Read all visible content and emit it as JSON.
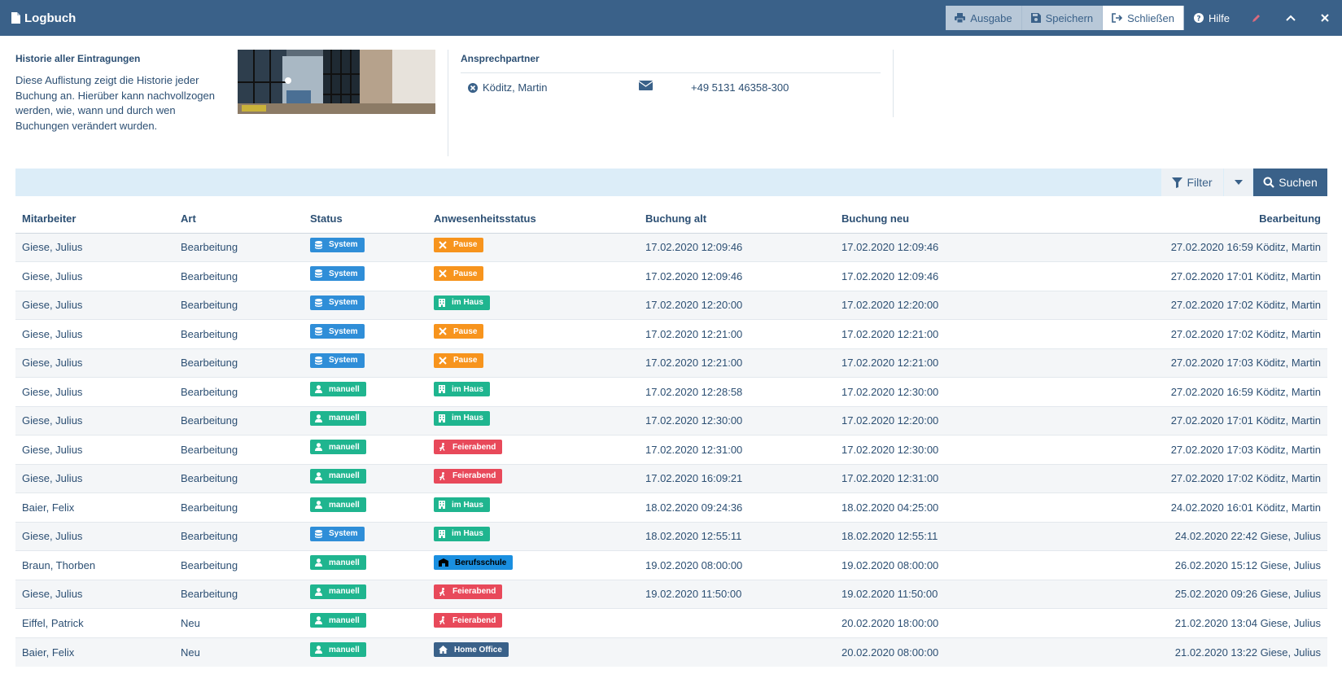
{
  "header": {
    "title": "Logbuch",
    "buttons": {
      "ausgabe": "Ausgabe",
      "speichern": "Speichern",
      "schliessen": "Schließen",
      "hilfe": "Hilfe"
    }
  },
  "info": {
    "title": "Historie aller Eintragungen",
    "text": "Diese Auflistung zeigt die Historie jeder Buchung an. Hierüber kann nachvollzogen werden, wie, wann und durch wen Buchungen verändert wurden."
  },
  "contact": {
    "title": "Ansprechpartner",
    "name": "Köditz, Martin",
    "phone": "+49 5131 46358-300"
  },
  "toolbar": {
    "filter": "Filter",
    "search": "Suchen"
  },
  "table": {
    "headers": [
      "Mitarbeiter",
      "Art",
      "Status",
      "Anwesenheitsstatus",
      "Buchung alt",
      "Buchung neu",
      "Bearbeitung"
    ],
    "rows": [
      [
        "Giese, Julius",
        "Bearbeitung",
        "System",
        "Pause",
        "17.02.2020 12:09:46",
        "17.02.2020 12:09:46",
        "27.02.2020 16:59 Köditz, Martin"
      ],
      [
        "Giese, Julius",
        "Bearbeitung",
        "System",
        "Pause",
        "17.02.2020 12:09:46",
        "17.02.2020 12:09:46",
        "27.02.2020 17:01 Köditz, Martin"
      ],
      [
        "Giese, Julius",
        "Bearbeitung",
        "System",
        "im Haus",
        "17.02.2020 12:20:00",
        "17.02.2020 12:20:00",
        "27.02.2020 17:02 Köditz, Martin"
      ],
      [
        "Giese, Julius",
        "Bearbeitung",
        "System",
        "Pause",
        "17.02.2020 12:21:00",
        "17.02.2020 12:21:00",
        "27.02.2020 17:02 Köditz, Martin"
      ],
      [
        "Giese, Julius",
        "Bearbeitung",
        "System",
        "Pause",
        "17.02.2020 12:21:00",
        "17.02.2020 12:21:00",
        "27.02.2020 17:03 Köditz, Martin"
      ],
      [
        "Giese, Julius",
        "Bearbeitung",
        "manuell",
        "im Haus",
        "17.02.2020 12:28:58",
        "17.02.2020 12:30:00",
        "27.02.2020 16:59 Köditz, Martin"
      ],
      [
        "Giese, Julius",
        "Bearbeitung",
        "manuell",
        "im Haus",
        "17.02.2020 12:30:00",
        "17.02.2020 12:20:00",
        "27.02.2020 17:01 Köditz, Martin"
      ],
      [
        "Giese, Julius",
        "Bearbeitung",
        "manuell",
        "Feierabend",
        "17.02.2020 12:31:00",
        "17.02.2020 12:30:00",
        "27.02.2020 17:03 Köditz, Martin"
      ],
      [
        "Giese, Julius",
        "Bearbeitung",
        "manuell",
        "Feierabend",
        "17.02.2020 16:09:21",
        "17.02.2020 12:31:00",
        "27.02.2020 17:02 Köditz, Martin"
      ],
      [
        "Baier, Felix",
        "Bearbeitung",
        "manuell",
        "im Haus",
        "18.02.2020 09:24:36",
        "18.02.2020 04:25:00",
        "24.02.2020 16:01 Köditz, Martin"
      ],
      [
        "Giese, Julius",
        "Bearbeitung",
        "System",
        "im Haus",
        "18.02.2020 12:55:11",
        "18.02.2020 12:55:11",
        "24.02.2020 22:42 Giese, Julius"
      ],
      [
        "Braun, Thorben",
        "Bearbeitung",
        "manuell",
        "Berufsschule",
        "19.02.2020 08:00:00",
        "19.02.2020 08:00:00",
        "26.02.2020 15:12 Giese, Julius"
      ],
      [
        "Giese, Julius",
        "Bearbeitung",
        "manuell",
        "Feierabend",
        "19.02.2020 11:50:00",
        "19.02.2020 11:50:00",
        "25.02.2020 09:26 Giese, Julius"
      ],
      [
        "Eiffel, Patrick",
        "Neu",
        "manuell",
        "Feierabend",
        "",
        "20.02.2020 18:00:00",
        "21.02.2020 13:04 Giese, Julius"
      ],
      [
        "Baier, Felix",
        "Neu",
        "manuell",
        "Home Office",
        "",
        "20.02.2020 08:00:00",
        "21.02.2020 13:22 Giese, Julius"
      ]
    ]
  },
  "colors": {
    "header": "#3a6189",
    "system": "#2f8ed8",
    "manuell": "#1fb58f",
    "pause": "#f7941d",
    "imhaus": "#1fb58f",
    "feierabend": "#e8495a",
    "berufsschule": "#1a8fe0",
    "homeoffice": "#3a6189"
  },
  "icons": {
    "System": "database-icon",
    "manuell": "user-icon",
    "Pause": "utensils-icon",
    "im Haus": "building-icon",
    "Feierabend": "running-icon",
    "Berufsschule": "school-icon",
    "Home Office": "home-icon"
  }
}
